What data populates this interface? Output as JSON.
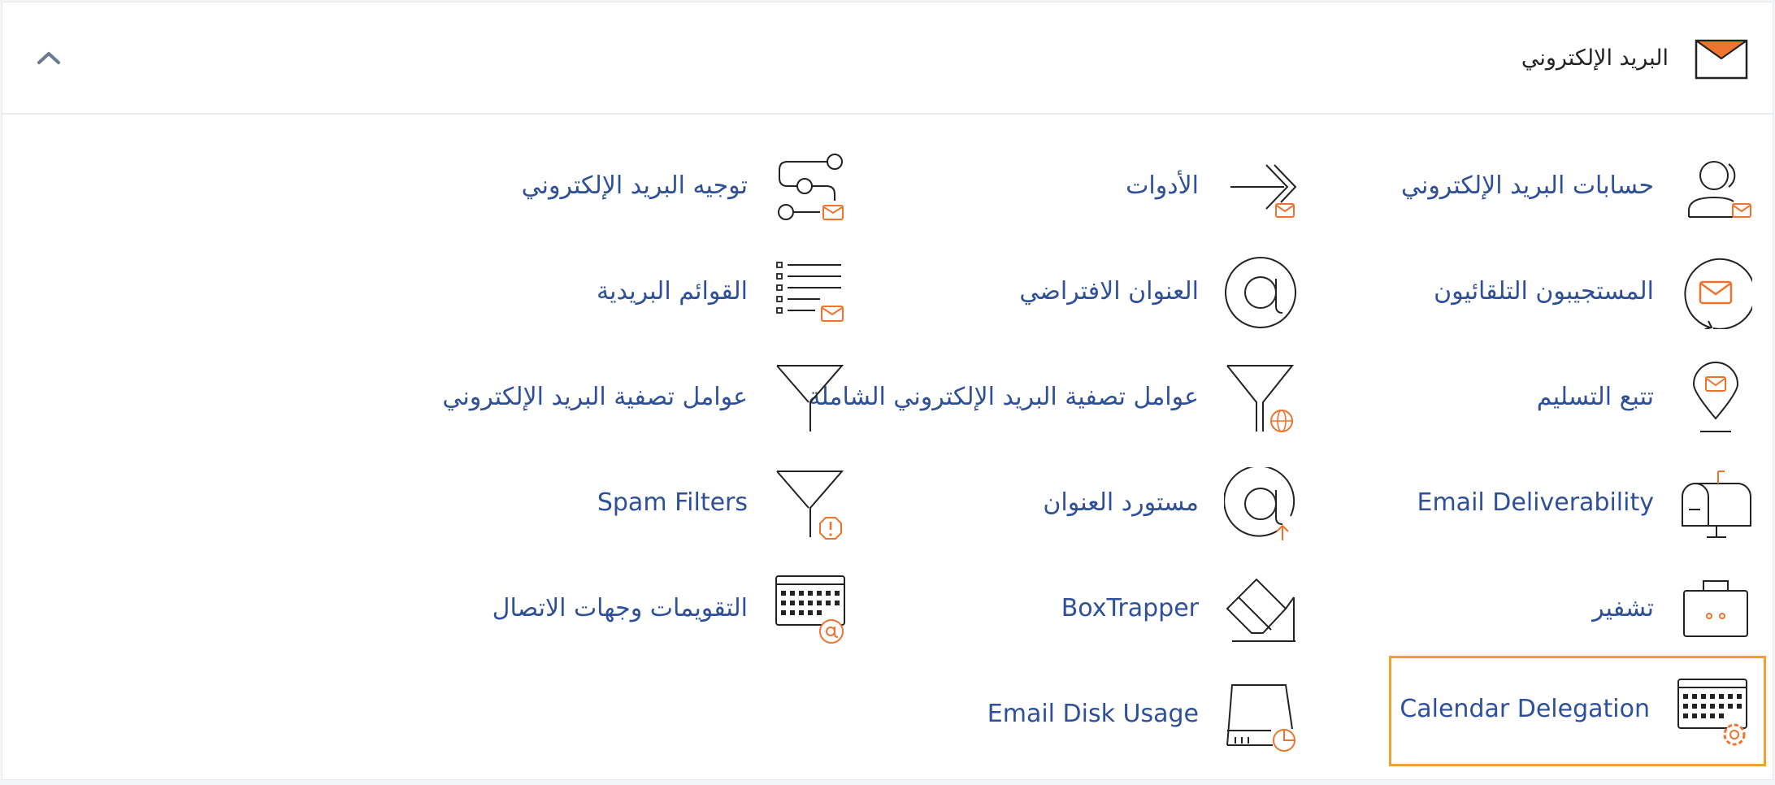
{
  "section": {
    "title": "البريد الإلكتروني",
    "collapse_icon": "chevron-up-icon",
    "header_icon": "envelope-icon"
  },
  "colors": {
    "accent": "#f0732d",
    "link": "#2e4f9a",
    "highlight_border": "#f0a030"
  },
  "tools": {
    "email_accounts": {
      "label": "حسابات البريد الإلكتروني",
      "icon": "user-mail-icon"
    },
    "tools": {
      "label": "الأدوات",
      "icon": "arrows-icon"
    },
    "forwarders": {
      "label": "توجيه البريد الإلكتروني",
      "icon": "route-icon"
    },
    "autoresponders": {
      "label": "المستجيبون التلقائيون",
      "icon": "autorespond-icon"
    },
    "default_address": {
      "label": "العنوان الافتراضي",
      "icon": "at-icon"
    },
    "mailing_lists": {
      "label": "القوائم البريدية",
      "icon": "list-mail-icon"
    },
    "track_delivery": {
      "label": "تتبع التسليم",
      "icon": "map-pin-mail-icon"
    },
    "global_filters": {
      "label": "عوامل تصفية البريد الإلكتروني الشاملة",
      "icon": "funnel-globe-icon"
    },
    "email_filters": {
      "label": "عوامل تصفية البريد الإلكتروني",
      "icon": "funnel-icon"
    },
    "deliverability": {
      "label": "Email Deliverability",
      "icon": "mailbox-icon"
    },
    "address_importer": {
      "label": "مستورد العنوان",
      "icon": "at-upload-icon"
    },
    "spam_filters": {
      "label": "Spam Filters",
      "icon": "funnel-alert-icon"
    },
    "encryption": {
      "label": "تشفير",
      "icon": "briefcase-lock-icon"
    },
    "boxtrapper": {
      "label": "BoxTrapper",
      "icon": "eraser-icon"
    },
    "calendars_contacts": {
      "label": "التقويمات وجهات الاتصال",
      "icon": "calendar-at-icon"
    },
    "calendar_delegation": {
      "label": "Calendar Delegation",
      "icon": "calendar-gear-icon"
    },
    "disk_usage": {
      "label": "Email Disk Usage",
      "icon": "disk-pie-icon"
    }
  }
}
